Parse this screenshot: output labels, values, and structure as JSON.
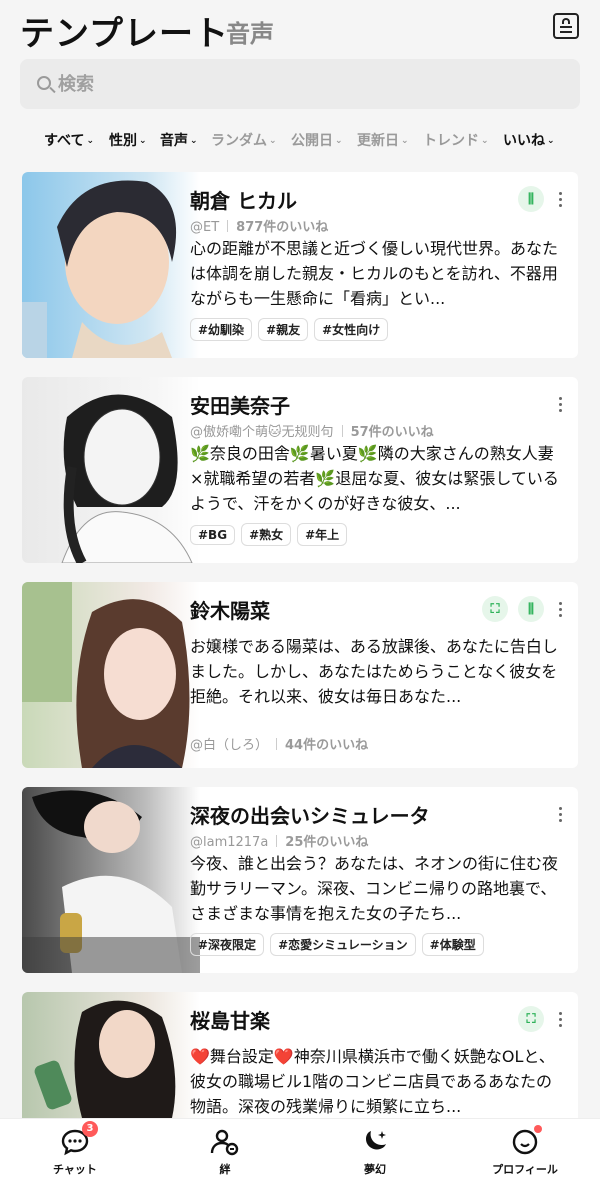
{
  "header": {
    "title": "テンプレート",
    "subtitle": "音声"
  },
  "search": {
    "placeholder": "検索"
  },
  "filters": [
    {
      "label": "すべて",
      "active": true
    },
    {
      "label": "性別",
      "active": true
    },
    {
      "label": "音声",
      "active": true
    },
    {
      "label": "ランダム",
      "active": false
    },
    {
      "label": "公開日",
      "active": false
    },
    {
      "label": "更新日",
      "active": false
    },
    {
      "label": "トレンド",
      "active": false
    },
    {
      "label": "いいね",
      "active": true
    }
  ],
  "cards": [
    {
      "name": "朝倉 ヒカル",
      "author": "@ET",
      "likes": "877件のいいね",
      "description": "心の距離が不思議と近づく優しい現代世界。あなたは体調を崩した親友・ヒカルのもとを訪れ、不器用ながらも一生懸命に「看病」とい...",
      "tags": [
        "#幼馴染",
        "#親友",
        "#女性向け"
      ],
      "actions": [
        "voice-icon"
      ]
    },
    {
      "name": "安田美奈子",
      "author": "@傲娇嘞个萌🐱无规则句",
      "likes": "57件のいいね",
      "description": "🌿奈良の田舎🌿暑い夏🌿隣の大家さんの熟女人妻×就職希望の若者🌿退屈な夏、彼女は緊張しているようで、汗をかくのが好きな彼女、...",
      "tags": [
        "#BG",
        "#熟女",
        "#年上"
      ],
      "actions": []
    },
    {
      "name": "鈴木陽菜",
      "author": "@白（しろ）",
      "likes": "44件のいいね",
      "description": "お嬢様である陽菜は、ある放課後、あなたに告白しました。しかし、あなたはためらうことなく彼女を拒絶。それ以来、彼女は毎日あなた...",
      "tags": [],
      "actions": [
        "expand-icon",
        "voice-icon"
      ]
    },
    {
      "name": "深夜の出会いシミュレータ",
      "author": "@lam1217a",
      "likes": "25件のいいね",
      "description": "今夜、誰と出会う？あなたは、ネオンの街に住む夜勤サラリーマン。深夜、コンビニ帰りの路地裏で、さまざまな事情を抱えた女の子たち...",
      "tags": [
        "#深夜限定",
        "#恋愛シミュレーション",
        "#体験型"
      ],
      "actions": []
    },
    {
      "name": "桜島甘楽",
      "author": "",
      "likes": "",
      "description": "❤️舞台設定❤️神奈川県横浜市で働く妖艶なOLと、彼女の職場ビル1階のコンビニ店員であるあなたの物語。深夜の残業帰りに頻繁に立ち...",
      "tags": [],
      "actions": [
        "expand-icon"
      ]
    }
  ],
  "nav": {
    "chat": {
      "label": "チャット",
      "badge": "3"
    },
    "bond": {
      "label": "絆"
    },
    "dream": {
      "label": "夢幻"
    },
    "profile": {
      "label": "プロフィール"
    }
  },
  "colors": {
    "accent_green": "#2fb25a",
    "badge_red": "#ff5a5a"
  }
}
